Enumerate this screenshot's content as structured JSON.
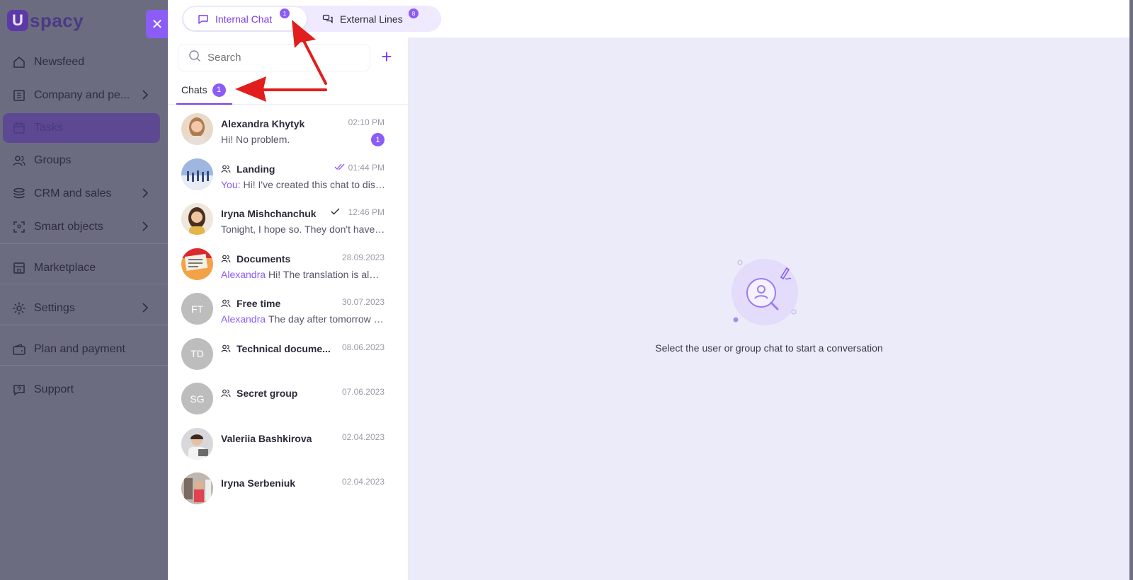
{
  "brand": {
    "name": "spacy",
    "mark": "U"
  },
  "sidebar": {
    "items": [
      {
        "label": "Newsfeed",
        "icon": "home-icon",
        "has_arrow": false
      },
      {
        "label": "Company and pe...",
        "icon": "building-icon",
        "has_arrow": true
      },
      {
        "label": "Tasks",
        "icon": "calendar-icon",
        "has_arrow": false,
        "active": true
      },
      {
        "label": "Groups",
        "icon": "users-icon",
        "has_arrow": false
      },
      {
        "label": "CRM and sales",
        "icon": "stack-icon",
        "has_arrow": true
      },
      {
        "label": "Smart objects",
        "icon": "scan-icon",
        "has_arrow": true
      },
      {
        "label": "Marketplace",
        "icon": "store-icon",
        "has_arrow": false
      },
      {
        "label": "Settings",
        "icon": "gear-icon",
        "has_arrow": true
      },
      {
        "label": "Plan and payment",
        "icon": "wallet-icon",
        "has_arrow": false
      },
      {
        "label": "Support",
        "icon": "help-icon",
        "has_arrow": false
      }
    ]
  },
  "close_label": "✕",
  "top_tabs": {
    "internal": {
      "label": "Internal Chat",
      "badge": "1"
    },
    "external": {
      "label": "External Lines",
      "badge": "8"
    }
  },
  "search": {
    "placeholder": "Search"
  },
  "add_label": "+",
  "list_tabs": {
    "chats": {
      "label": "Chats",
      "badge": "1"
    }
  },
  "chats": [
    {
      "name": "Alexandra Khytyk",
      "time": "02:10 PM",
      "sender": "",
      "message": "Hi! No problem.",
      "unread": "1",
      "group": false,
      "status": "",
      "avatar": "photo",
      "initials": ""
    },
    {
      "name": "Landing",
      "time": "01:44 PM",
      "sender": "You:",
      "message": "Hi! I've created this chat to discuss the landing",
      "unread": "",
      "group": true,
      "status": "read",
      "avatar": "photo",
      "initials": ""
    },
    {
      "name": "Iryna Mishchanchuk",
      "time": "12:46 PM",
      "sender": "",
      "message": "Tonight, I hope so. They don't have the translation yet",
      "unread": "",
      "group": false,
      "status": "sent",
      "avatar": "photo",
      "initials": ""
    },
    {
      "name": "Documents",
      "time": "28.09.2023",
      "sender": "Alexandra",
      "message": "Hi! The translation is almost ready",
      "unread": "",
      "group": true,
      "status": "",
      "avatar": "photo",
      "initials": ""
    },
    {
      "name": "Free time",
      "time": "30.07.2023",
      "sender": "Alexandra",
      "message": "The day after tomorrow we are going",
      "unread": "",
      "group": true,
      "status": "",
      "avatar": "initials",
      "initials": "FT"
    },
    {
      "name": "Technical docume...",
      "time": "08.06.2023",
      "sender": "",
      "message": "",
      "unread": "",
      "group": true,
      "status": "",
      "avatar": "initials",
      "initials": "TD"
    },
    {
      "name": "Secret group",
      "time": "07.06.2023",
      "sender": "",
      "message": "",
      "unread": "",
      "group": true,
      "status": "",
      "avatar": "initials",
      "initials": "SG"
    },
    {
      "name": "Valeriia Bashkirova",
      "time": "02.04.2023",
      "sender": "",
      "message": "",
      "unread": "",
      "group": false,
      "status": "",
      "avatar": "photo",
      "initials": ""
    },
    {
      "name": "Iryna Serbeniuk",
      "time": "02.04.2023",
      "sender": "",
      "message": "",
      "unread": "",
      "group": false,
      "status": "",
      "avatar": "photo",
      "initials": ""
    }
  ],
  "empty_state": {
    "text": "Select the user or group chat to start a conversation"
  },
  "colors": {
    "accent": "#8b5cf6",
    "annotation": "#e11d1d",
    "empty_bg": "#ecebf9"
  }
}
